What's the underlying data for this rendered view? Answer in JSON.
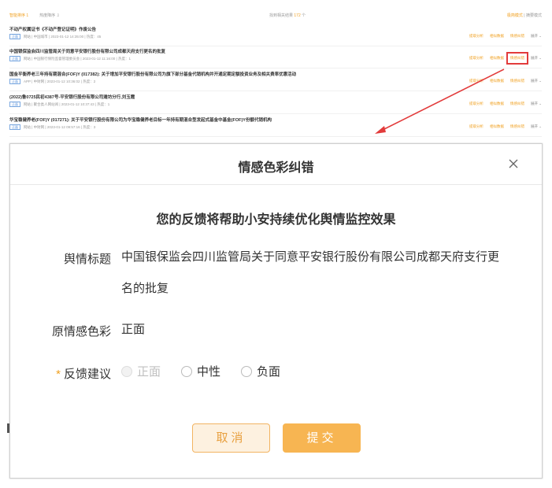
{
  "background_list": {
    "topbar": {
      "left_items": [
        "智能排序 1",
        "热度降序 ⇩"
      ],
      "mid_prefix": "找到相关结果",
      "mid_count": "172",
      "mid_suffix": "个",
      "right_highlight": "极简模式",
      "right_sep": "|",
      "right_normal": "摘要模式"
    },
    "rows": [
      {
        "title": "不动产权属证书《不动产登记证明》作废公告",
        "tag": "正面",
        "meta": "网站  |  中国城市  |  2023-01-12 14:35:00  |  热度：45",
        "actions": [
          "提取分析",
          "相似数据",
          "情感纠错"
        ],
        "more": "展开"
      },
      {
        "title": "中国银保监会四川监管局关于同意平安银行股份有限公司成都天府支行更名的批复",
        "tag": "正面",
        "meta": "网站  |  中国银行保险监督管理委员会  |  2023-01-12 11:16:00  |  热度：1",
        "actions": [
          "提取分析",
          "相似数据",
          "情感纠错"
        ],
        "more": "展开"
      },
      {
        "title": "国金平衡养老三年持有期混合(FOF)Y (017382): 关于增加平安银行股份有限公司为旗下部分基金代销机构并开通定期定额投资业务及相关费率优惠活动",
        "tag": "正面",
        "meta": "APP  |  中财网  |  2023-01-12 10:36:02  |  热度：2",
        "actions": [
          "提取分析",
          "相似数据",
          "情感纠错"
        ],
        "more": "展开"
      },
      {
        "title": "(2022)鲁0725民初4387号-平安银行股份有限公司潍坊分行,刘玉霞",
        "tag": "正面",
        "meta": "网站  |  聚合类人网站阅  |  2023-01-12 10:37:43  |  热度：1",
        "actions": [
          "提取分析",
          "相似数据",
          "情感纠错"
        ],
        "more": "展开"
      },
      {
        "title": "华宝稳健养老(FOF)Y (017271): 关于平安银行股份有限公司为华宝稳健养老目标一年持有期混合型发起式基金中基金(FOF)Y份额代销机构",
        "tag": "正面",
        "meta": "网站  |  中财网  |  2023-01-12 09:57:16  |  热度：3",
        "actions": [
          "提取分析",
          "相似数据",
          "情感纠错"
        ],
        "more": "展开"
      }
    ]
  },
  "dialog": {
    "title": "情感色彩纠错",
    "subtitle": "您的反馈将帮助小安持续优化舆情监控效果",
    "fields": {
      "title_label": "舆情标题",
      "title_value_line1": "中国银保监会四川监管局关于同意平安银行股份有限公司成都天府支行更",
      "title_value_line2": "名的批复",
      "original_label": "原情感色彩",
      "original_value": "正面",
      "feedback_star": "*",
      "feedback_label": "反馈建议"
    },
    "options": [
      {
        "label": "正面",
        "state": "disabled"
      },
      {
        "label": "中性",
        "state": "unchecked"
      },
      {
        "label": "负面",
        "state": "unchecked"
      }
    ],
    "cancel_label": "取消",
    "submit_label": "提交"
  },
  "colors": {
    "accent": "#f7b552",
    "accent_text": "#f0a020",
    "highlight_box": "#e23b3b",
    "tag_blue": "#4a88d8"
  }
}
